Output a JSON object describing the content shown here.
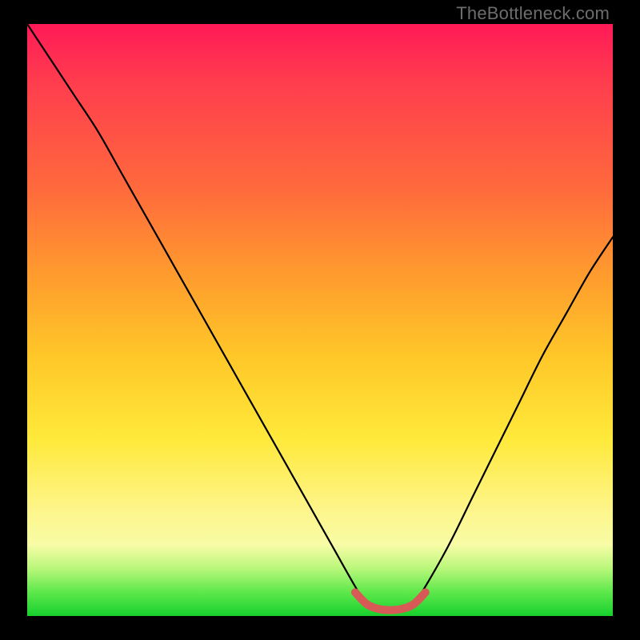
{
  "watermark": "TheBottleneck.com",
  "chart_data": {
    "type": "line",
    "title": "",
    "xlabel": "",
    "ylabel": "",
    "xlim": [
      0,
      100
    ],
    "ylim": [
      0,
      100
    ],
    "grid": false,
    "series": [
      {
        "name": "bottleneck-curve",
        "x": [
          0,
          4,
          8,
          12,
          16,
          20,
          24,
          28,
          32,
          36,
          40,
          44,
          48,
          52,
          56,
          58,
          60,
          62,
          64,
          66,
          68,
          72,
          76,
          80,
          84,
          88,
          92,
          96,
          100
        ],
        "values": [
          100,
          94,
          88,
          82,
          75,
          68,
          61,
          54,
          47,
          40,
          33,
          26,
          19,
          12,
          5,
          2,
          1,
          1,
          1,
          2,
          5,
          12,
          20,
          28,
          36,
          44,
          51,
          58,
          64
        ]
      },
      {
        "name": "flat-highlight",
        "x": [
          56,
          58,
          60,
          62,
          64,
          66,
          68
        ],
        "values": [
          4,
          2,
          1.2,
          1,
          1.2,
          2,
          4
        ]
      }
    ],
    "colors": {
      "curve": "#000000",
      "highlight": "#d85a56",
      "gradient_top": "#ff1a57",
      "gradient_mid": "#ffc728",
      "gradient_bottom": "#17d02e"
    }
  }
}
